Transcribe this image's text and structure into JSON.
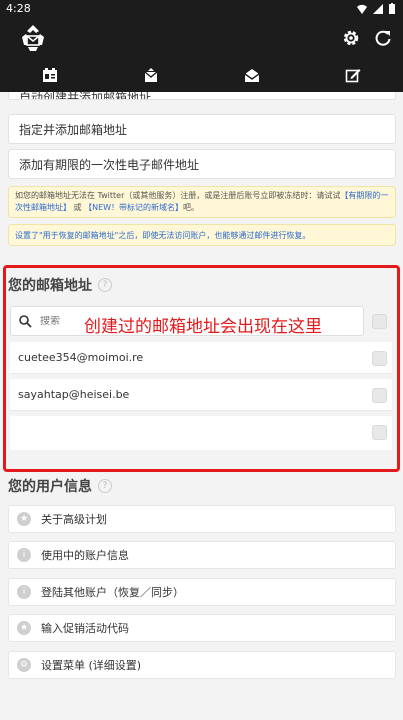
{
  "status": {
    "time": "4:28"
  },
  "tabs": [
    {
      "icon": "contact-card-icon"
    },
    {
      "icon": "mail-recycle-icon"
    },
    {
      "icon": "mail-open-icon"
    },
    {
      "icon": "compose-icon"
    }
  ],
  "top_buttons": {
    "partial": "自动创建并添加邮箱地址",
    "specify": "指定并添加邮箱地址",
    "temporary": "添加有期限的一次性电子邮件地址"
  },
  "notes": {
    "twitter_pre": "如您的邮箱地址无法在 Twitter（或其他服务）注册，或是注册后账号立即被冻结时：请试试",
    "twitter_link1": "【有期限的一次性邮箱地址】",
    "twitter_mid": "或",
    "twitter_link2": "【NEW！带标记的新域名】",
    "twitter_post": "吧。",
    "recovery": "设置了\"用于恢复的邮箱地址\"之后，即使无法访问账户，也能够通过邮件进行恢复。"
  },
  "addresses": {
    "title": "您的邮箱地址",
    "search_placeholder": "搜索",
    "annotation": "创建过的邮箱地址会出现在这里",
    "items": [
      "cuetee354@moimoi.re",
      "sayahtap@heisei.be",
      ""
    ]
  },
  "user_info": {
    "title": "您的用户信息",
    "items": [
      {
        "label": "关于高级计划",
        "icon": "★"
      },
      {
        "label": "使用中的账户信息",
        "icon": "i"
      },
      {
        "label": "登陆其他账户（恢复／同步）",
        "icon": "i"
      },
      {
        "label": "输入促销活动代码",
        "icon": "★"
      },
      {
        "label": "设置菜单 (详细设置)",
        "icon": "⚙"
      }
    ]
  },
  "colors": {
    "accent_red": "#e3191c",
    "bar_bg": "#1c1c1c",
    "link_blue": "#2a6ad0"
  }
}
